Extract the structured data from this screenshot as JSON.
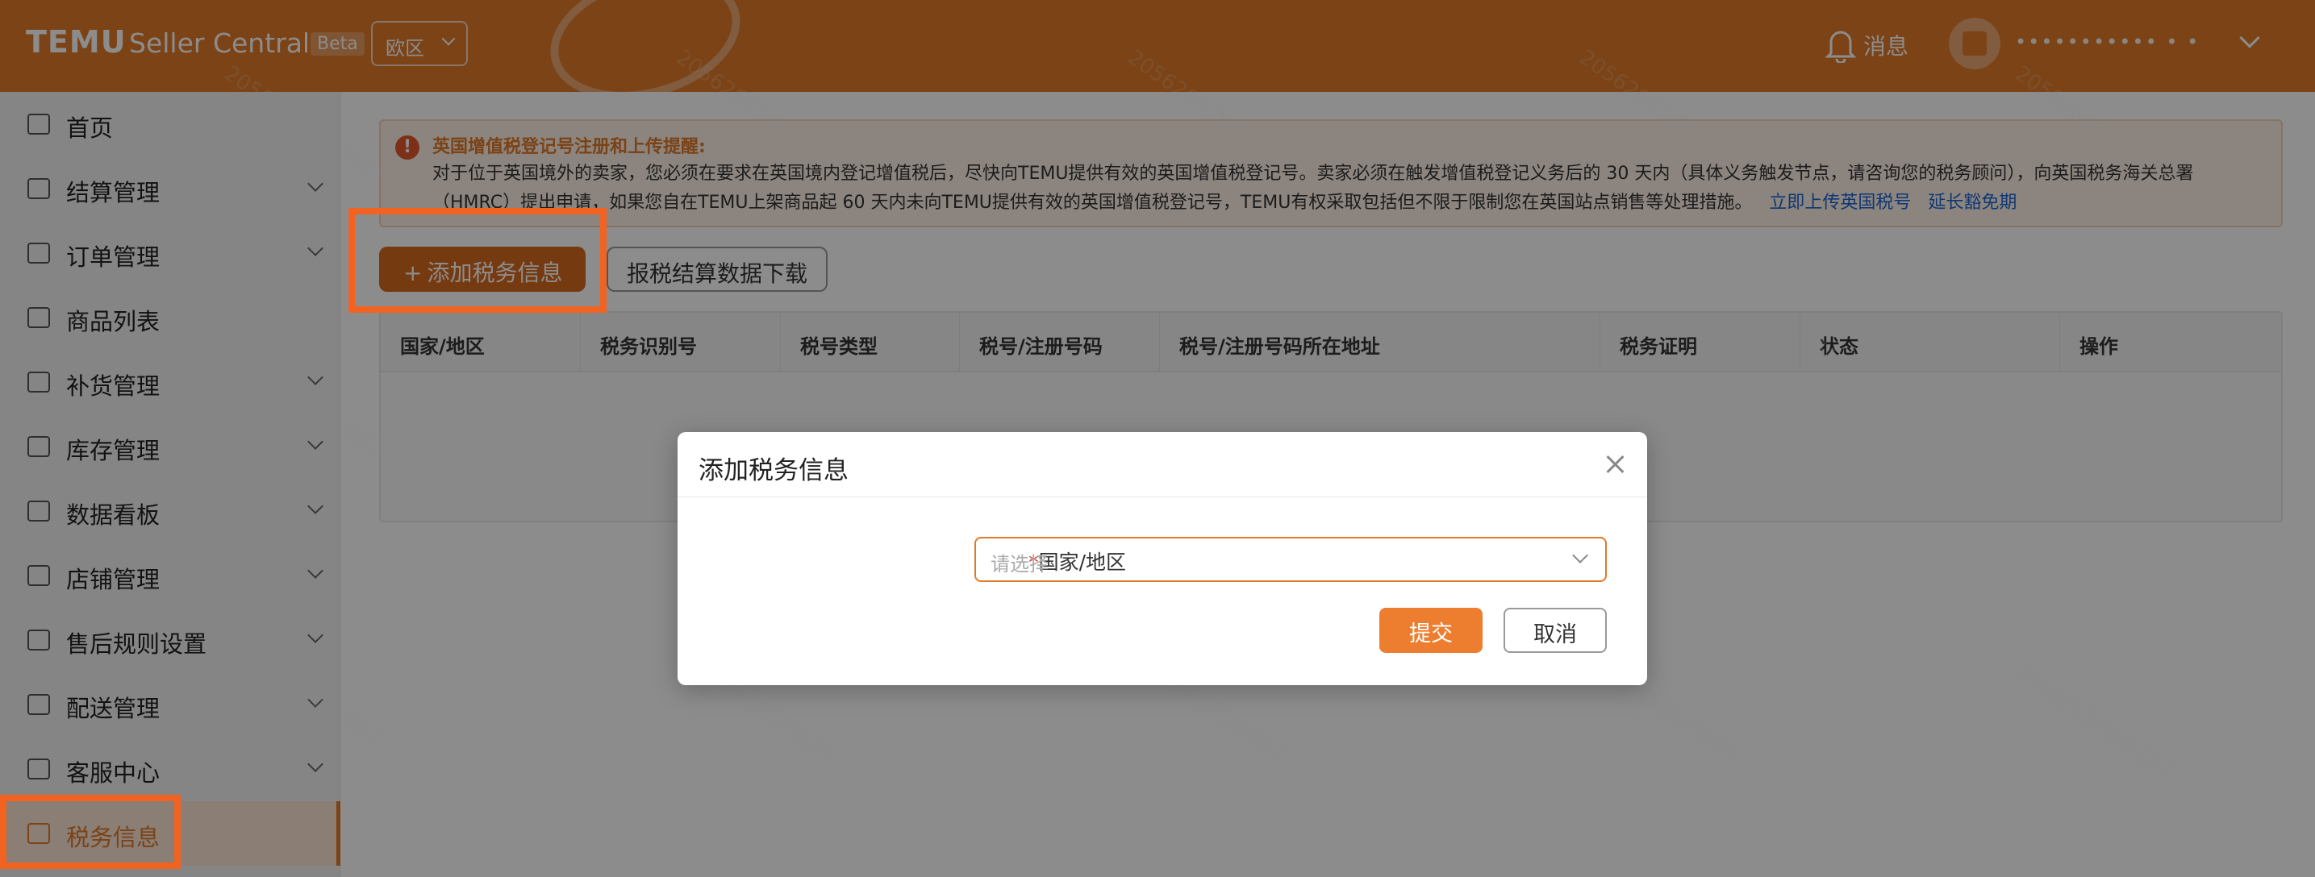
{
  "header": {
    "logo": "TEMU",
    "subtitle": "Seller Central",
    "beta": "Beta",
    "region": "欧区",
    "messages_label": "消息",
    "username": "••••••••••• •  •",
    "brand_color": "#e07a28"
  },
  "sidebar": {
    "items": [
      {
        "label": "首页",
        "icon": "home-icon",
        "expandable": false
      },
      {
        "label": "结算管理",
        "icon": "wallet-icon",
        "expandable": true
      },
      {
        "label": "订单管理",
        "icon": "cart-icon",
        "expandable": true
      },
      {
        "label": "商品列表",
        "icon": "list-icon",
        "expandable": false
      },
      {
        "label": "补货管理",
        "icon": "restock-icon",
        "expandable": true
      },
      {
        "label": "库存管理",
        "icon": "warehouse-icon",
        "expandable": true
      },
      {
        "label": "数据看板",
        "icon": "dashboard-icon",
        "expandable": true
      },
      {
        "label": "店铺管理",
        "icon": "store-icon",
        "expandable": true
      },
      {
        "label": "售后规则设置",
        "icon": "after-sales-icon",
        "expandable": true
      },
      {
        "label": "配送管理",
        "icon": "truck-icon",
        "expandable": true
      },
      {
        "label": "客服中心",
        "icon": "chat-icon",
        "expandable": true
      },
      {
        "label": "税务信息",
        "icon": "tax-icon",
        "expandable": false,
        "active": true
      }
    ]
  },
  "notice": {
    "title": "英国增值税登记号注册和上传提醒:",
    "text": "对于位于英国境外的卖家，您必须在要求在英国境内登记增值税后，尽快向TEMU提供有效的英国增值税登记号。卖家必须在触发增值税登记义务后的 30 天内（具体义务触发节点，请咨询您的税务顾问），向英国税务海关总署（HMRC）提出申请，如果您自在TEMU上架商品起 60 天内未向TEMU提供有效的英国增值税登记号，TEMU有权采取包括但不限于限制您在英国站点销售等处理措施。",
    "link_upload": "立即上传英国税号",
    "link_extend": "延长豁免期"
  },
  "toolbar": {
    "add_button": "添加税务信息",
    "download_button": "报税结算数据下载"
  },
  "table": {
    "columns": [
      "国家/地区",
      "税务识别号",
      "税号类型",
      "税号/注册号码",
      "税号/注册号码所在地址",
      "税务证明",
      "状态",
      "操作"
    ]
  },
  "watermark_text": "20562652845687",
  "modal": {
    "title": "添加税务信息",
    "field_label": "国家/地区",
    "required_mark": "*",
    "select_placeholder": "请选择",
    "submit": "提交",
    "cancel": "取消"
  }
}
